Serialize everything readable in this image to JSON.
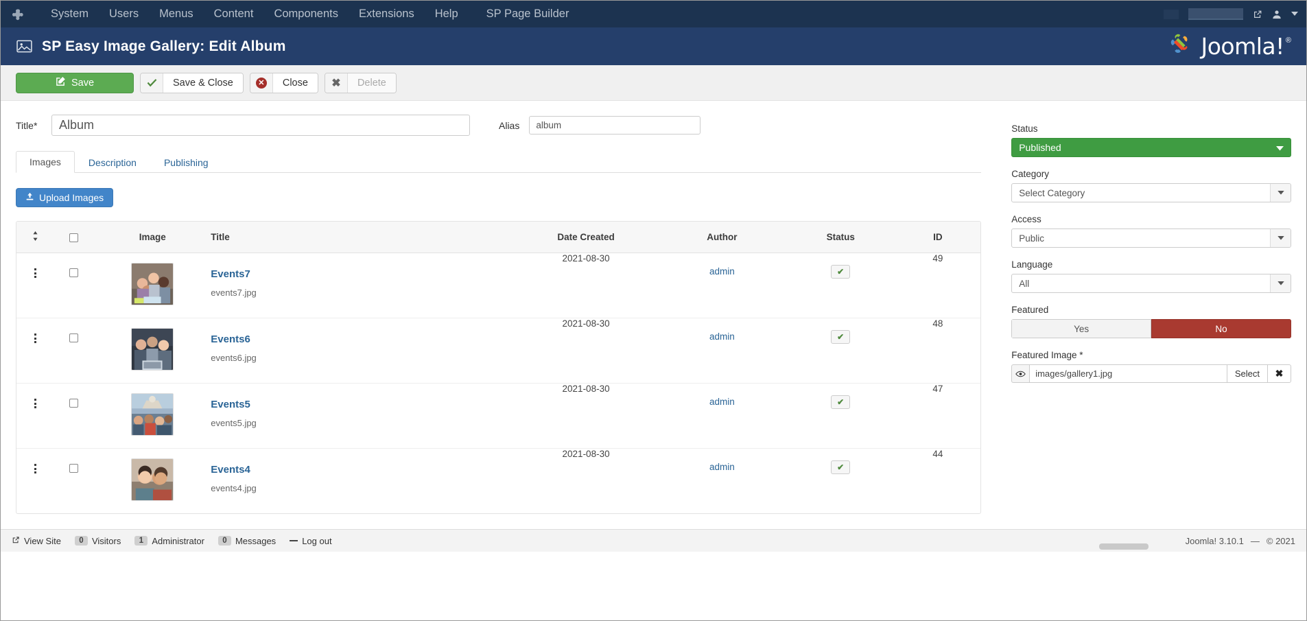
{
  "admin_menu": {
    "brand_icon": "joomla-logo-icon",
    "items": [
      "System",
      "Users",
      "Menus",
      "Content",
      "Components",
      "Extensions",
      "Help",
      "SP Page Builder"
    ],
    "right_icons": [
      "external-link-icon",
      "user-icon",
      "chevron-down-icon"
    ]
  },
  "page_header": {
    "icon": "image-gallery-icon",
    "title": "SP Easy Image Gallery: Edit Album",
    "logo_text": "Joomla!",
    "logo_reg": "®"
  },
  "toolbar": {
    "save_label": "Save",
    "save_close_label": "Save & Close",
    "close_label": "Close",
    "delete_label": "Delete",
    "save_icon": "edit-square-icon",
    "save_close_icon": "check-icon",
    "close_icon": "x-circle-icon",
    "delete_icon": "x-icon"
  },
  "form": {
    "title_label": "Title",
    "title_required": "*",
    "title_value": "Album",
    "alias_label": "Alias",
    "alias_value": "album"
  },
  "tabs": [
    {
      "label": "Images",
      "active": true
    },
    {
      "label": "Description",
      "active": false
    },
    {
      "label": "Publishing",
      "active": false
    }
  ],
  "upload": {
    "label": "Upload Images",
    "icon": "upload-icon"
  },
  "table": {
    "headers": {
      "sort": "sort-icon",
      "check": "select-all-checkbox",
      "image": "Image",
      "title": "Title",
      "date_created": "Date Created",
      "author": "Author",
      "status": "Status",
      "id": "ID"
    },
    "rows": [
      {
        "title": "Events7",
        "filename": "events7.jpg",
        "date": "2021-08-30",
        "author": "admin",
        "status_icon": "check-icon",
        "id": "49",
        "thumb": "people-group-photo"
      },
      {
        "title": "Events6",
        "filename": "events6.jpg",
        "date": "2021-08-30",
        "author": "admin",
        "status_icon": "check-icon",
        "id": "48",
        "thumb": "people-laptop-photo"
      },
      {
        "title": "Events5",
        "filename": "events5.jpg",
        "date": "2021-08-30",
        "author": "admin",
        "status_icon": "check-icon",
        "id": "47",
        "thumb": "crowd-building-photo"
      },
      {
        "title": "Events4",
        "filename": "events4.jpg",
        "date": "2021-08-30",
        "author": "admin",
        "status_icon": "check-icon",
        "id": "44",
        "thumb": "two-women-photo"
      }
    ]
  },
  "sidebar": {
    "status_label": "Status",
    "status_value": "Published",
    "category_label": "Category",
    "category_value": "Select Category",
    "access_label": "Access",
    "access_value": "Public",
    "language_label": "Language",
    "language_value": "All",
    "featured_label": "Featured",
    "featured_yes": "Yes",
    "featured_no": "No",
    "featured_image_label": "Featured Image *",
    "featured_image_value": "images/gallery1.jpg",
    "featured_image_select": "Select",
    "featured_image_clear_icon": "x-icon",
    "featured_image_preview_icon": "eye-icon"
  },
  "footer": {
    "view_site": "View Site",
    "view_site_icon": "external-link-icon",
    "visitors_count": "0",
    "visitors_label": "Visitors",
    "admin_count": "1",
    "admin_label": "Administrator",
    "messages_count": "0",
    "messages_label": "Messages",
    "logout_label": "Log out",
    "logout_icon": "logout-icon",
    "version": "Joomla! 3.10.1",
    "separator": "—",
    "copyright": "© 2021"
  },
  "colors": {
    "topbar": "#1c3350",
    "header": "#253f6b",
    "save_green": "#5cab52",
    "status_green": "#3f9c42",
    "featured_red": "#a93a30",
    "link_blue": "#2a6496",
    "upload_blue": "#4285c9"
  }
}
